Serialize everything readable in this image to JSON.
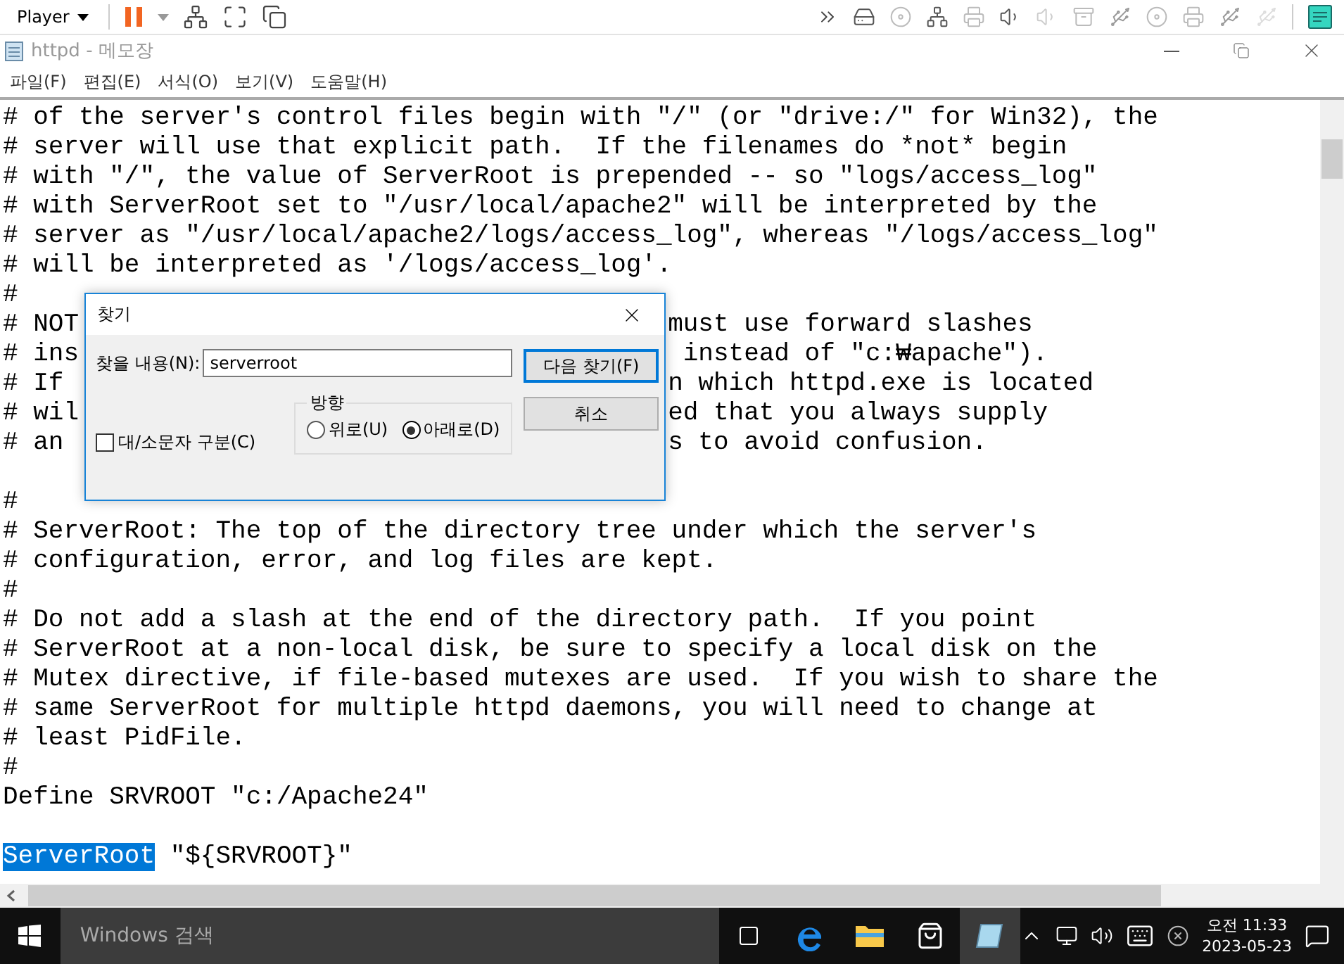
{
  "player": {
    "label": "Player"
  },
  "notepad": {
    "title": "httpd - 메모장",
    "menu": [
      "파일(F)",
      "편집(E)",
      "서식(O)",
      "보기(V)",
      "도움말(H)"
    ]
  },
  "editor": {
    "lines": [
      {
        "kind": "text",
        "text": "# of the server's control files begin with \"/\" (or \"drive:/\" for Win32), the"
      },
      {
        "kind": "text",
        "text": "# server will use that explicit path.  If the filenames do *not* begin"
      },
      {
        "kind": "text",
        "text": "# with \"/\", the value of ServerRoot is prepended -- so \"logs/access_log\""
      },
      {
        "kind": "text",
        "text": "# with ServerRoot set to \"/usr/local/apache2\" will be interpreted by the"
      },
      {
        "kind": "text",
        "text": "# server as \"/usr/local/apache2/logs/access_log\", whereas \"/logs/access_log\""
      },
      {
        "kind": "text",
        "text": "# will be interpreted as '/logs/access_log'."
      },
      {
        "kind": "text",
        "text": "#"
      },
      {
        "kind": "split",
        "left": "# NOT",
        "right": "must use forward slashes"
      },
      {
        "kind": "split",
        "left": "# ins",
        "right": " instead of \"c:₩apache\")."
      },
      {
        "kind": "split",
        "left": "# If",
        "right": "n which httpd.exe is located"
      },
      {
        "kind": "split",
        "left": "# wil",
        "right": "ed that you always supply"
      },
      {
        "kind": "split",
        "left": "# an",
        "right": "s to avoid confusion."
      },
      {
        "kind": "blank"
      },
      {
        "kind": "text",
        "text": "#"
      },
      {
        "kind": "text",
        "text": "# ServerRoot: The top of the directory tree under which the server's"
      },
      {
        "kind": "text",
        "text": "# configuration, error, and log files are kept."
      },
      {
        "kind": "text",
        "text": "#"
      },
      {
        "kind": "text",
        "text": "# Do not add a slash at the end of the directory path.  If you point"
      },
      {
        "kind": "text",
        "text": "# ServerRoot at a non-local disk, be sure to specify a local disk on the"
      },
      {
        "kind": "text",
        "text": "# Mutex directive, if file-based mutexes are used.  If you wish to share the"
      },
      {
        "kind": "text",
        "text": "# same ServerRoot for multiple httpd daemons, you will need to change at"
      },
      {
        "kind": "text",
        "text": "# least PidFile."
      },
      {
        "kind": "text",
        "text": "#"
      },
      {
        "kind": "text",
        "text": "Define SRVROOT \"c:/Apache24\""
      },
      {
        "kind": "blank"
      },
      {
        "kind": "segments",
        "segments": [
          {
            "text": "ServerRoot",
            "selected": true
          },
          {
            "text": " \"${SRVROOT}\"",
            "selected": false
          }
        ]
      }
    ]
  },
  "find_dialog": {
    "title": "찾기",
    "find_label": "찾을 내용(N):",
    "value": "serverroot",
    "find_next": "다음 찾기(F)",
    "cancel": "취소",
    "direction": {
      "label": "방향",
      "options": [
        {
          "label": "위로(U)",
          "selected": false
        },
        {
          "label": "아래로(D)",
          "selected": true
        }
      ]
    },
    "match_case": {
      "label": "대/소문자 구분(C)",
      "checked": false
    }
  },
  "taskbar": {
    "search_placeholder": "Windows 검색",
    "time": "오전 11:33",
    "date": "2023-05-23"
  }
}
